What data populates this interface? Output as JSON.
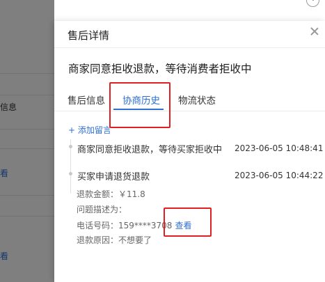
{
  "background": {
    "left_column_text": "信息",
    "left_column_links": [
      "看",
      "看"
    ]
  },
  "drawer": {
    "title": "售后详情",
    "status_headline": "商家同意拒收退款，等待消费者拒收中",
    "tabs": [
      {
        "label": "售后信息",
        "active": false
      },
      {
        "label": "协商历史",
        "active": true
      },
      {
        "label": "物流状态",
        "active": false
      }
    ],
    "add_comment": "+ 添加留言",
    "history": [
      {
        "title": "商家同意拒收退款，等待买家拒收中",
        "time": "2023-06-05 10:48:41"
      },
      {
        "title": "买家申请退货退款",
        "time": "2023-06-05 10:44:22",
        "details": {
          "refund_amount": "退款金额：￥11.8",
          "problem_desc": "问题描述为：",
          "phone_label": "电话号码：159****3708",
          "view_label": "查看",
          "reason": "退款原因：不想要了"
        }
      }
    ]
  },
  "colors": {
    "accent": "#2d6fd6",
    "highlight": "#e02020",
    "overlay": "rgba(0,0,0,0.5)"
  }
}
